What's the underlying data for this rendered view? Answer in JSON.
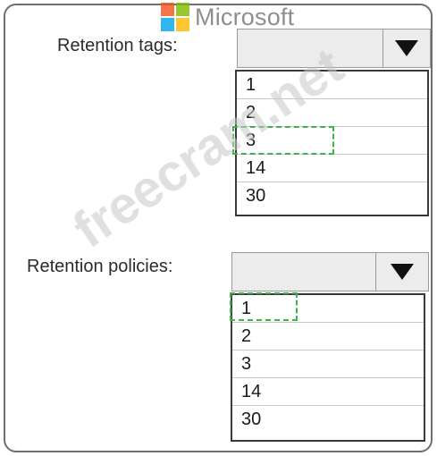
{
  "brand": {
    "name": "Microsoft",
    "logo_colors": [
      "#f2541b",
      "#7fba00",
      "#00a4ef",
      "#ffb900"
    ]
  },
  "watermark": "freecram.net",
  "retention_tags": {
    "label": "Retention tags:",
    "selected_value": "",
    "options": [
      "1",
      "2",
      "3",
      "14",
      "30"
    ],
    "highlighted_option": "3"
  },
  "retention_policies": {
    "label": "Retention policies:",
    "selected_value": "",
    "options": [
      "1",
      "2",
      "3",
      "14",
      "30"
    ],
    "highlighted_option": "1"
  },
  "colors": {
    "highlight_dash": "#3bb54a"
  }
}
